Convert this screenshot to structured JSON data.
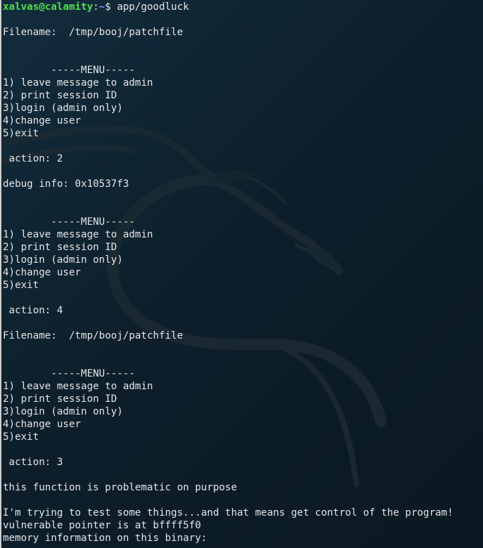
{
  "prompt": {
    "user_host": "xalvas@calamity",
    "colon": ":",
    "path": "~",
    "symbol": "$ ",
    "command": "app/goodluck"
  },
  "output_lines": [
    "",
    "Filename:  /tmp/booj/patchfile",
    "",
    "",
    "        -----MENU-----",
    "1) leave message to admin",
    "2) print session ID",
    "3)login (admin only)",
    "4)change user",
    "5)exit",
    "",
    " action: 2",
    "",
    "debug info: 0x10537f3",
    "",
    "",
    "        -----MENU-----",
    "1) leave message to admin",
    "2) print session ID",
    "3)login (admin only)",
    "4)change user",
    "5)exit",
    "",
    " action: 4",
    "",
    "Filename:  /tmp/booj/patchfile",
    "",
    "",
    "        -----MENU-----",
    "1) leave message to admin",
    "2) print session ID",
    "3)login (admin only)",
    "4)change user",
    "5)exit",
    "",
    " action: 3",
    "",
    "this function is problematic on purpose",
    "",
    "I'm trying to test some things...and that means get control of the program!",
    "vulnerable pointer is at bffff5f0",
    "memory information on this binary:"
  ],
  "colors": {
    "background": "#0f2230",
    "text": "#e6e6e6",
    "prompt_user": "#4fe04f",
    "prompt_path": "#6aa0ff"
  }
}
